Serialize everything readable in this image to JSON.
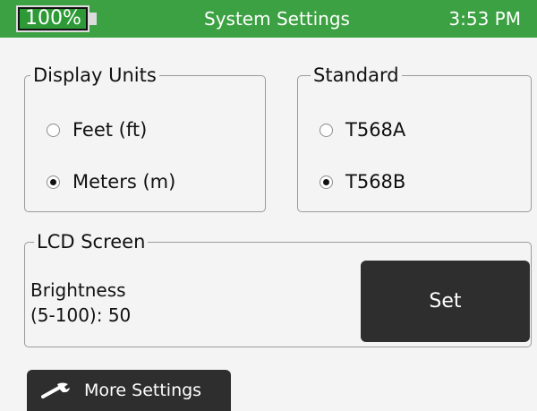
{
  "status_bar": {
    "battery_label": "100%",
    "battery_level_percent": 100,
    "title": "System Settings",
    "time": "3:53 PM",
    "color": "#3ca142"
  },
  "display_units": {
    "legend": "Display Units",
    "options": [
      {
        "label": "Feet (ft)",
        "selected": false
      },
      {
        "label": "Meters (m)",
        "selected": true
      }
    ]
  },
  "standard": {
    "legend": "Standard",
    "options": [
      {
        "label": "T568A",
        "selected": false
      },
      {
        "label": "T568B",
        "selected": true
      }
    ]
  },
  "lcd_screen": {
    "legend": "LCD Screen",
    "brightness_label": "Brightness",
    "brightness_range": "(5-100): 50",
    "set_label": "Set"
  },
  "more_settings": {
    "label": "More Settings",
    "icon": "wrench-icon"
  }
}
